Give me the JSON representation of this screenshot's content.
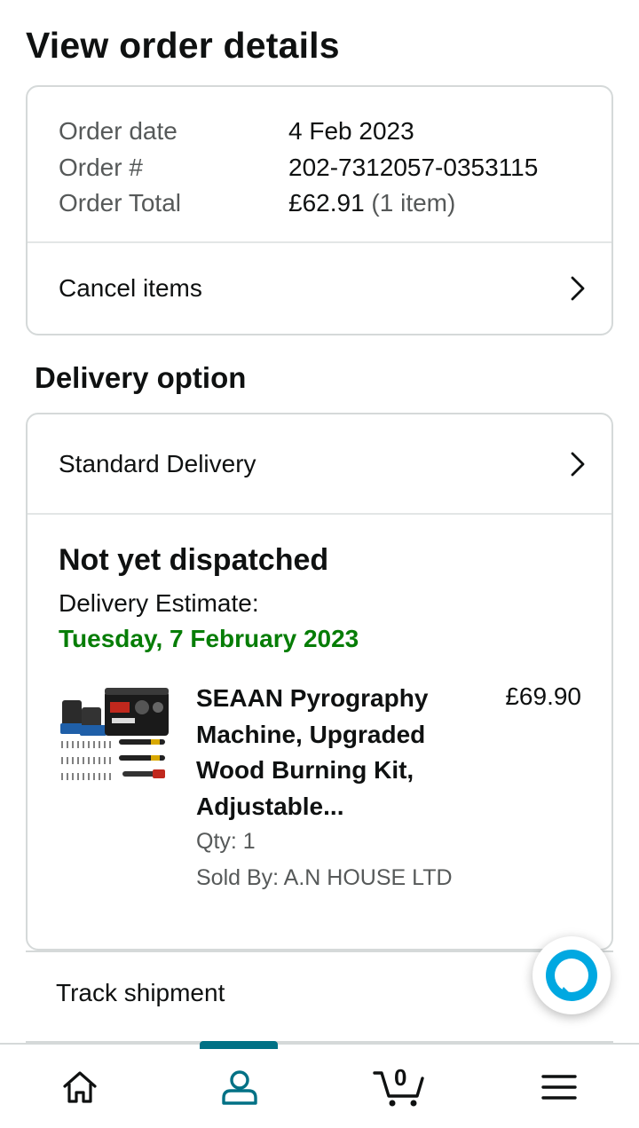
{
  "page": {
    "title": "View order details"
  },
  "summary": {
    "rows": [
      {
        "label": "Order date",
        "value": "4 Feb 2023"
      },
      {
        "label": "Order #",
        "value": "202-7312057-0353115"
      },
      {
        "label": "Order Total",
        "value": "£62.91",
        "extra": "(1 item)"
      }
    ],
    "cancel_label": "Cancel items"
  },
  "delivery": {
    "section_title": "Delivery option",
    "option_label": "Standard Delivery",
    "status": "Not yet dispatched",
    "estimate_label": "Delivery Estimate:",
    "estimate_date": "Tuesday, 7 February 2023",
    "estimate_color": "#067d06"
  },
  "item": {
    "name": "SEAAN Pyrography Machine, Upgraded Wood Burning Kit, Adjustable...",
    "price": "£69.90",
    "qty": "Qty: 1",
    "seller": "Sold By: A.N HOUSE LTD",
    "image_icon": "pyrography-kit-image"
  },
  "track": {
    "label": "Track shipment"
  },
  "nav": {
    "items": [
      {
        "name": "home",
        "icon": "home-icon"
      },
      {
        "name": "account",
        "icon": "person-icon",
        "active": true
      },
      {
        "name": "cart",
        "icon": "cart-icon",
        "count": "0"
      },
      {
        "name": "menu",
        "icon": "hamburger-icon"
      }
    ],
    "accent": "#007185"
  },
  "assistant": {
    "icon": "alexa-icon",
    "color": "#00a8e1"
  }
}
